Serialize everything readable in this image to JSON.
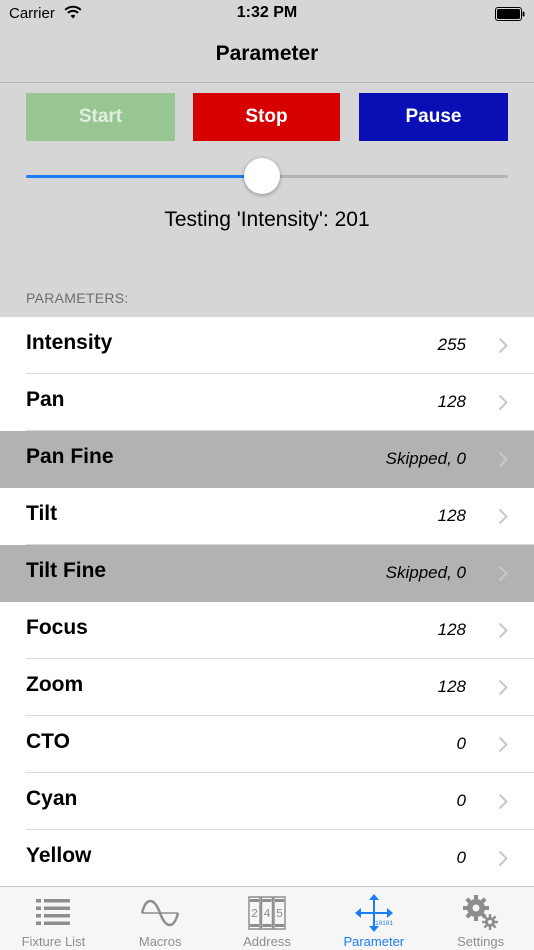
{
  "status_bar": {
    "carrier": "Carrier",
    "time": "1:32 PM"
  },
  "nav": {
    "title": "Parameter"
  },
  "controls": {
    "start_label": "Start",
    "stop_label": "Stop",
    "pause_label": "Pause",
    "start_color": "#97c693",
    "stop_color": "#d60000",
    "pause_color": "#0a0fb5"
  },
  "slider": {
    "value_fraction": 0.49,
    "accent_color": "#1a7ff5"
  },
  "testing_label": "Testing 'Intensity': 201",
  "section_header": "PARAMETERS:",
  "parameters": [
    {
      "name": "Intensity",
      "value": "255",
      "skipped": false
    },
    {
      "name": "Pan",
      "value": "128",
      "skipped": false
    },
    {
      "name": "Pan Fine",
      "value": "Skipped, 0",
      "skipped": true
    },
    {
      "name": "Tilt",
      "value": "128",
      "skipped": false
    },
    {
      "name": "Tilt Fine",
      "value": "Skipped, 0",
      "skipped": true
    },
    {
      "name": "Focus",
      "value": "128",
      "skipped": false
    },
    {
      "name": "Zoom",
      "value": "128",
      "skipped": false
    },
    {
      "name": "CTO",
      "value": "0",
      "skipped": false
    },
    {
      "name": "Cyan",
      "value": "0",
      "skipped": false
    },
    {
      "name": "Yellow",
      "value": "0",
      "skipped": false
    }
  ],
  "tabs": [
    {
      "label": "Fixture List",
      "icon": "list-icon",
      "active": false
    },
    {
      "label": "Macros",
      "icon": "sine-wave-icon",
      "active": false
    },
    {
      "label": "Address",
      "icon": "address-counter-icon",
      "active": false
    },
    {
      "label": "Parameter",
      "icon": "move-arrows-icon",
      "active": true
    },
    {
      "label": "Settings",
      "icon": "gears-icon",
      "active": false
    }
  ]
}
